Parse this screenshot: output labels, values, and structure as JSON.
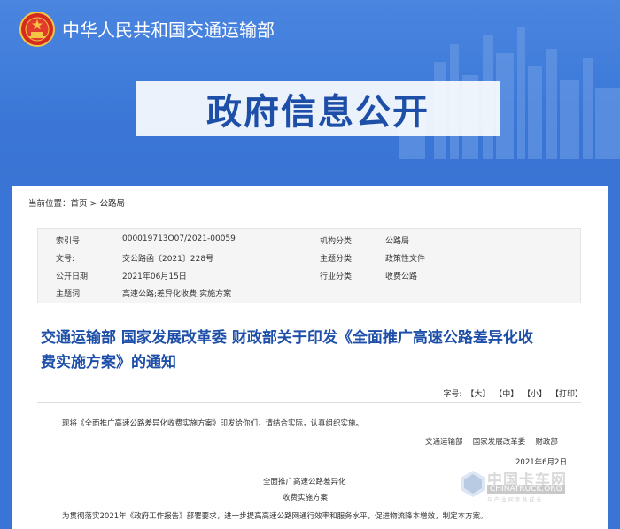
{
  "header": {
    "ministry_name": "中华人民共和国交通运输部",
    "section_title": "政府信息公开"
  },
  "breadcrumb": {
    "prefix": "当前位置：",
    "home": "首页",
    "sep": " > ",
    "current": "公路局"
  },
  "meta": {
    "index_label": "索引号:",
    "index_value": "000019713O07/2021-00059",
    "org_label": "机构分类:",
    "org_value": "公路局",
    "doc_no_label": "文号:",
    "doc_no_value": "交公路函〔2021〕228号",
    "topic_label": "主题分类:",
    "topic_value": "政策性文件",
    "date_label": "公开日期:",
    "date_value": "2021年06月15日",
    "industry_label": "行业分类:",
    "industry_value": "收费公路",
    "keywords_label": "主题词:",
    "keywords_value": "高速公路;差异化收费;实施方案"
  },
  "article": {
    "title_line1": "交通运输部 国家发展改革委 财政部关于印发《全面推广高速公路差异化收",
    "title_line2": "费实施方案》的通知",
    "font_label": "字号:",
    "font_large": "【大】",
    "font_medium": "【中】",
    "font_small": "【小】",
    "print": "【打印】",
    "para1": "现将《全面推广高速公路差异化收费实施方案》印发给你们，请结合实际，认真组织实施。",
    "signers": "交通运输部　 国家发展改革委 　财政部",
    "sign_date": "2021年6月2日",
    "plan_title_1": "全面推广高速公路差异化",
    "plan_title_2": "收费实施方案",
    "para2": "为贯彻落实2021年《政府工作报告》部署要求，进一步提高高速公路网通行效率和服务水平，促进物流降本增效，制定本方案。"
  },
  "watermark": {
    "cn": "中国卡车网",
    "en": "CHINATRUCK.ORG",
    "sub": "与 产 业 同 步 共 成 长"
  },
  "colors": {
    "banner_blue": "#3a74d4",
    "title_blue": "#1d4fa8"
  }
}
